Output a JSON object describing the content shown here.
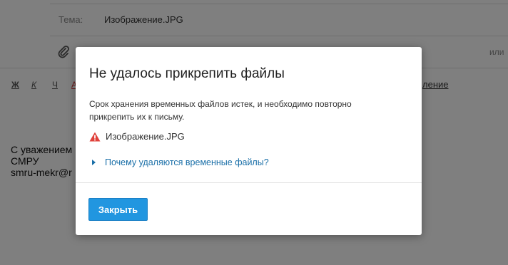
{
  "background": {
    "subject_label": "Тема:",
    "subject_value": "Изображение.JPG",
    "or_label": "или",
    "format_buttons": [
      "Ж",
      "К",
      "Ч",
      "A"
    ],
    "right_link": "ление",
    "signature": [
      "С уважением",
      "СМРУ",
      "smru-mekr@r"
    ]
  },
  "dialog": {
    "title": "Не удалось прикрепить файлы",
    "message": "Срок хранения временных файлов истек, и необходимо повторно прикрепить их к письму.",
    "file": {
      "icon": "warning-icon",
      "name": "Изображение.JPG"
    },
    "why_link": "Почему удаляются временные файлы?",
    "close_label": "Закрыть"
  },
  "colors": {
    "accent": "#2196e0",
    "link": "#1a6fa8",
    "warning": "#e0403a"
  }
}
